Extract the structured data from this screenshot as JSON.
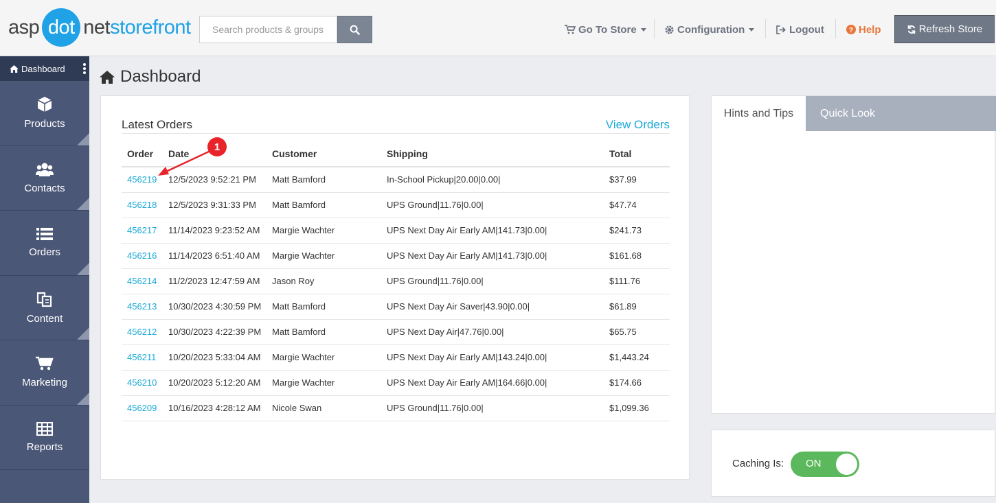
{
  "logo": {
    "part1": "asp",
    "part2": "dot",
    "part3": "net",
    "part4": "storefront"
  },
  "search": {
    "placeholder": "Search products & groups"
  },
  "topnav": {
    "go_to_store": "Go To Store",
    "configuration": "Configuration",
    "logout": "Logout",
    "help": "Help",
    "refresh": "Refresh Store"
  },
  "colors": {
    "accent": "#1fa2e6",
    "link": "#1ba9d8",
    "help": "#e8763a",
    "sidebar": "#4b5776",
    "annotation": "#e8242a"
  },
  "sidebar": {
    "top": "Dashboard",
    "items": [
      {
        "label": "Products",
        "icon": "cube-icon"
      },
      {
        "label": "Contacts",
        "icon": "users-icon"
      },
      {
        "label": "Orders",
        "icon": "list-icon"
      },
      {
        "label": "Content",
        "icon": "copy-icon"
      },
      {
        "label": "Marketing",
        "icon": "cart-icon"
      },
      {
        "label": "Reports",
        "icon": "table-icon"
      }
    ]
  },
  "page_title": "Dashboard",
  "orders": {
    "title": "Latest Orders",
    "view_link": "View Orders",
    "columns": [
      "Order",
      "Date",
      "Customer",
      "Shipping",
      "Total"
    ],
    "rows": [
      [
        "456219",
        "12/5/2023 9:52:21 PM",
        "Matt Bamford",
        "In-School Pickup|20.00|0.00|",
        "$37.99"
      ],
      [
        "456218",
        "12/5/2023 9:31:33 PM",
        "Matt Bamford",
        "UPS Ground|11.76|0.00|",
        "$47.74"
      ],
      [
        "456217",
        "11/14/2023 9:23:52 AM",
        "Margie Wachter",
        "UPS Next Day Air Early AM|141.73|0.00|",
        "$241.73"
      ],
      [
        "456216",
        "11/14/2023 6:51:40 AM",
        "Margie Wachter",
        "UPS Next Day Air Early AM|141.73|0.00|",
        "$161.68"
      ],
      [
        "456214",
        "11/2/2023 12:47:59 AM",
        "Jason Roy",
        "UPS Ground|11.76|0.00|",
        "$111.76"
      ],
      [
        "456213",
        "10/30/2023 4:30:59 PM",
        "Matt Bamford",
        "UPS Next Day Air Saver|43.90|0.00|",
        "$61.89"
      ],
      [
        "456212",
        "10/30/2023 4:22:39 PM",
        "Matt Bamford",
        "UPS Next Day Air|47.76|0.00|",
        "$65.75"
      ],
      [
        "456211",
        "10/20/2023 5:33:04 AM",
        "Margie Wachter",
        "UPS Next Day Air Early AM|143.24|0.00|",
        "$1,443.24"
      ],
      [
        "456210",
        "10/20/2023 5:12:20 AM",
        "Margie Wachter",
        "UPS Next Day Air Early AM|164.66|0.00|",
        "$174.66"
      ],
      [
        "456209",
        "10/16/2023 4:28:12 AM",
        "Nicole Swan",
        "UPS Ground|11.76|0.00|",
        "$1,099.36"
      ]
    ]
  },
  "annotation": {
    "number": "1"
  },
  "tips": {
    "tab_active": "Hints and Tips",
    "tab_inactive": "Quick Look"
  },
  "caching": {
    "label": "Caching Is:",
    "state": "ON"
  }
}
